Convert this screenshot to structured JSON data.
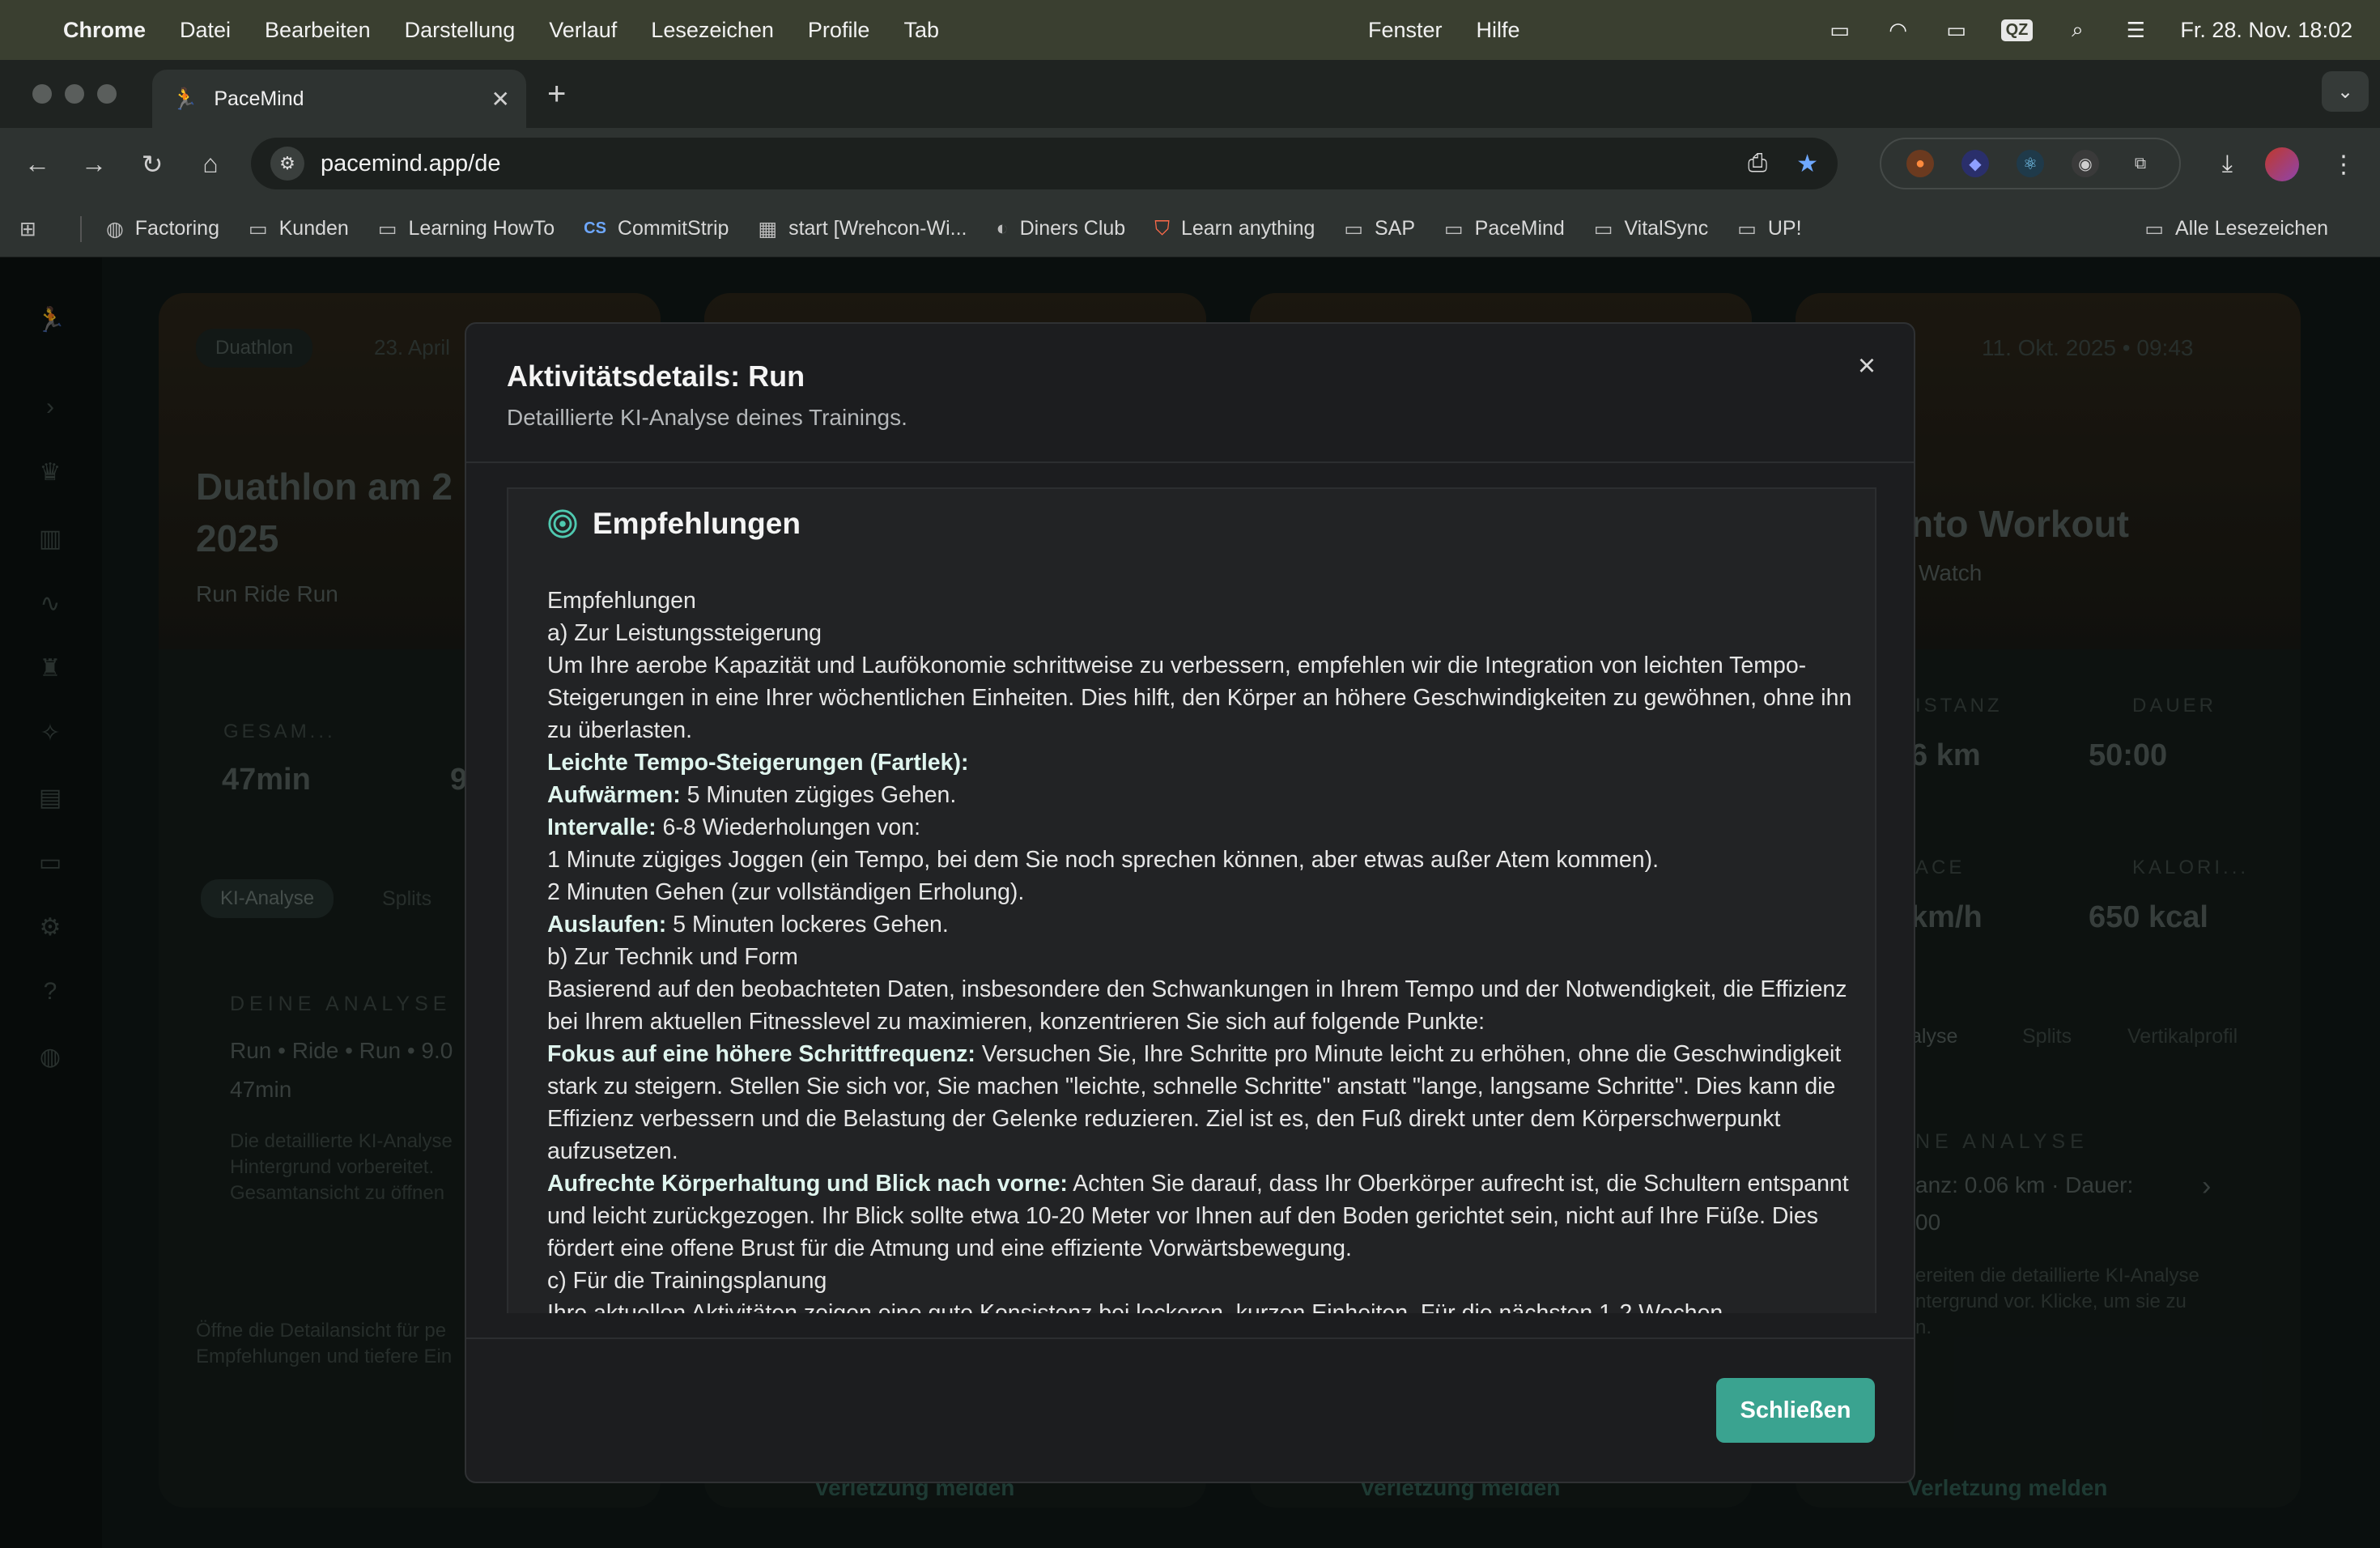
{
  "menubar": {
    "app": "Chrome",
    "items": [
      "Datei",
      "Bearbeiten",
      "Darstellung",
      "Verlauf",
      "Lesezeichen",
      "Profile",
      "Tab"
    ],
    "center_items": [
      "Fenster",
      "Hilfe"
    ],
    "qz": "QZ",
    "datetime": "Fr. 28. Nov.  18:02"
  },
  "browser": {
    "tab_title": "PaceMind",
    "url": "pacemind.app/de"
  },
  "bookmarks": {
    "items": [
      "Factoring",
      "Kunden",
      "Learning HowTo",
      "CommitStrip",
      "start [Wrehcon-Wi...",
      "Diners Club",
      "Learn anything",
      "SAP",
      "PaceMind",
      "VitalSync",
      "UP!"
    ],
    "all": "Alle Lesezeichen"
  },
  "background": {
    "card1_badge": "Duathlon",
    "card1_date": "23. April",
    "card1_title_line1": "Duathlon am 2",
    "card1_title_line2": "2025",
    "card1_sports": "Run   Ride   Run",
    "card1_stat_label": "GESAM...",
    "card1_stat_value": "47min",
    "card1_stat2_value": "9",
    "card1_tab_active": "KI-Analyse",
    "card1_tab2": "Splits",
    "card1_analysis_label": "DEINE ANALYSE",
    "card1_analysis_line1": "Run • Ride • Run • 9.0",
    "card1_analysis_line2": "47min",
    "card1_analysis_desc1": "Die detaillierte KI-Analyse",
    "card1_analysis_desc2": "Hintergrund vorbereitet.",
    "card1_analysis_desc3": "Gesamtansicht zu öffnen",
    "card1_hint1": "Öffne die Detailansicht für pe",
    "card1_hint2": "Empfehlungen und tiefere Ein",
    "card4_date": "11. Okt. 2025 • 09:43",
    "card4_title": "nto Workout",
    "card4_source": "Watch",
    "card4_stat1_label": "ISTANZ",
    "card4_stat1_value": "6 km",
    "card4_stat2_label": "DAUER",
    "card4_stat2_value": "50:00",
    "card4_stat3_label": "ACE",
    "card4_stat3_value": "km/h",
    "card4_stat4_label": "KALORI...",
    "card4_stat4_value": "650 kcal",
    "card4_tab1": "alyse",
    "card4_tab2": "Splits",
    "card4_tab3": "Vertikalprofil",
    "card4_analysis_label": "NE ANALYSE",
    "card4_analysis_line1": "anz: 0.06 km · Dauer:",
    "card4_analysis_line2": "00",
    "card4_desc1": "ereiten die detaillierte KI-Analyse",
    "card4_desc2": "ntergrund vor. Klicke, um sie zu",
    "card4_desc3": "n.",
    "footer_link": "Verletzung melden"
  },
  "modal": {
    "title": "Aktivitätsdetails: Run",
    "subtitle": "Detaillierte KI-Analyse deines Trainings.",
    "section_title": "Empfehlungen",
    "close_button": "Schließen"
  },
  "recommendations": [
    {
      "bold": "",
      "text": "Empfehlungen"
    },
    {
      "bold": "",
      "text": "a) Zur Leistungssteigerung"
    },
    {
      "bold": "",
      "text": "Um Ihre aerobe Kapazität und Laufökonomie schrittweise zu verbessern, empfehlen wir die Integration von leichten Tempo-Steigerungen in eine Ihrer wöchentlichen Einheiten. Dies hilft, den Körper an höhere Geschwindigkeiten zu gewöhnen, ohne ihn zu überlasten."
    },
    {
      "bold": "Leichte Tempo-Steigerungen (Fartlek):",
      "text": ""
    },
    {
      "bold": "Aufwärmen:",
      "text": " 5 Minuten zügiges Gehen."
    },
    {
      "bold": "Intervalle:",
      "text": " 6-8 Wiederholungen von:"
    },
    {
      "bold": "",
      "text": "1 Minute zügiges Joggen (ein Tempo, bei dem Sie noch sprechen können, aber etwas außer Atem kommen)."
    },
    {
      "bold": "",
      "text": "2 Minuten Gehen (zur vollständigen Erholung)."
    },
    {
      "bold": "Auslaufen:",
      "text": " 5 Minuten lockeres Gehen."
    },
    {
      "bold": "",
      "text": "b) Zur Technik und Form"
    },
    {
      "bold": "",
      "text": "Basierend auf den beobachteten Daten, insbesondere den Schwankungen in Ihrem Tempo und der Notwendigkeit, die Effizienz bei Ihrem aktuellen Fitnesslevel zu maximieren, konzentrieren Sie sich auf folgende Punkte:"
    },
    {
      "bold": "Fokus auf eine höhere Schrittfrequenz:",
      "text": " Versuchen Sie, Ihre Schritte pro Minute leicht zu erhöhen, ohne die Geschwindigkeit stark zu steigern. Stellen Sie sich vor, Sie machen \"leichte, schnelle Schritte\" anstatt \"lange, langsame Schritte\". Dies kann die Effizienz verbessern und die Belastung der Gelenke reduzieren. Ziel ist es, den Fuß direkt unter dem Körperschwerpunkt aufzusetzen."
    },
    {
      "bold": "Aufrechte Körperhaltung und Blick nach vorne:",
      "text": " Achten Sie darauf, dass Ihr Oberkörper aufrecht ist, die Schultern entspannt und leicht zurückgezogen. Ihr Blick sollte etwa 10-20 Meter vor Ihnen auf den Boden gerichtet sein, nicht auf Ihre Füße. Dies fördert eine offene Brust für die Atmung und eine effiziente Vorwärtsbewegung."
    },
    {
      "bold": "",
      "text": "c) Für die Trainingsplanung"
    },
    {
      "bold": "",
      "text": "Ihre aktuellen Aktivitäten zeigen eine gute Konsistenz bei lockeren, kurzen Einheiten. Für die nächsten 1-2 Wochen"
    }
  ]
}
